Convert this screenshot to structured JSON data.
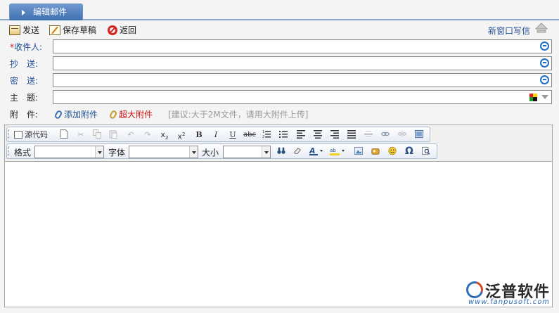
{
  "tab": {
    "title": "编辑邮件"
  },
  "actions": {
    "send": "发送",
    "save_draft": "保存草稿",
    "back": "返回",
    "new_window": "新窗口写信"
  },
  "form": {
    "to_required_mark": "*",
    "to_label": "收件人:",
    "cc_label": "抄　送:",
    "bcc_label": "密　送:",
    "subject_label": "主　题:",
    "attach_label": "附　件:",
    "add_attachment": "添加附件",
    "large_attachment": "超大附件",
    "attach_tip": "[建议:大于2M文件，请用大附件上传]",
    "to_value": "",
    "cc_value": "",
    "bcc_value": "",
    "subject_value": ""
  },
  "editor": {
    "source_label": "源代码",
    "format_label": "格式",
    "font_label": "字体",
    "size_label": "大小",
    "format_value": "",
    "font_value": "",
    "size_value": ""
  },
  "logo": {
    "name": "泛普软件",
    "url": "www.fanpusoft.com"
  }
}
